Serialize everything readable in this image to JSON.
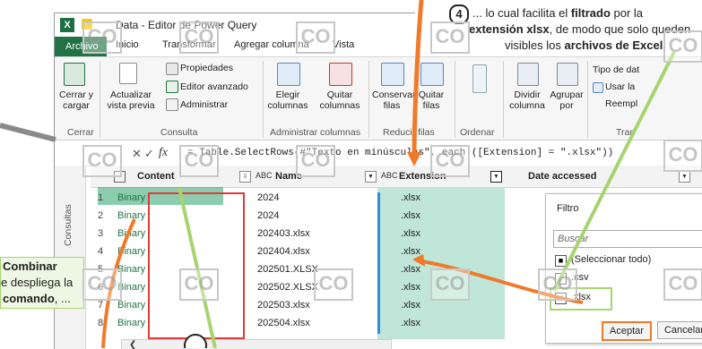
{
  "window": {
    "title": "Data - Editor de Power Query",
    "app_badge": "X"
  },
  "tabs": [
    "Archivo",
    "Inicio",
    "Transformar",
    "Agregar columna",
    "Vista"
  ],
  "ribbon": {
    "close_apply": "Cerrar y cargar",
    "refresh": "Actualizar vista previa",
    "properties": "Propiedades",
    "advanced_editor": "Editor avanzado",
    "manage": "Administrar",
    "choose_columns": "Elegir columnas",
    "remove_columns": "Quitar columnas",
    "keep_rows": "Conservar filas",
    "remove_rows": "Quitar filas",
    "split_column": "Dividir columna",
    "group_by": "Agrupar por",
    "data_type": "Tipo de dat",
    "use_first_row": "Usar la",
    "replace": "Reempl",
    "groups": {
      "close": "Cerrar",
      "query": "Consulta",
      "manage_cols": "Administrar columnas",
      "reduce_rows": "Reducir filas",
      "sort": "Ordenar",
      "transform": "Tran"
    }
  },
  "formula": {
    "fx": "fx",
    "text": "= Table.SelectRows(#\"Texto en minúsculas\", each ([Extension] = \".xlsx\"))"
  },
  "queries_label": "Consultas",
  "columns": [
    "Content",
    "Name",
    "Extension",
    "Date accessed"
  ],
  "rows": [
    {
      "n": "1",
      "content": "Binary",
      "name": "2024",
      "ext": ".xlsx"
    },
    {
      "n": "2",
      "content": "Binary",
      "name": "2024",
      "ext": ".xlsx"
    },
    {
      "n": "3",
      "content": "Binary",
      "name": "202403.xlsx",
      "ext": ".xlsx"
    },
    {
      "n": "4",
      "content": "Binary",
      "name": "202404.xlsx",
      "ext": ".xlsx"
    },
    {
      "n": "5",
      "content": "Binary",
      "name": "202501.XLSX",
      "ext": ".xlsx"
    },
    {
      "n": "6",
      "content": "Binary",
      "name": "202502.XLSX",
      "ext": ".xlsx"
    },
    {
      "n": "7",
      "content": "Binary",
      "name": "202503.xlsx",
      "ext": ".xlsx"
    },
    {
      "n": "8",
      "content": "Binary",
      "name": "202504.xlsx",
      "ext": ".xlsx"
    }
  ],
  "filter": {
    "title": "Filtro",
    "search_placeholder": "Buscar",
    "items": [
      {
        "label": "(Seleccionar todo)",
        "mark": "■"
      },
      {
        "label": ".csv",
        "mark": ""
      },
      {
        "label": ".xlsx",
        "mark": "✓"
      }
    ],
    "accept": "Aceptar",
    "cancel": "Cancelar"
  },
  "callouts": {
    "step_number": "4",
    "step4_line1a": "... lo cual facilita el ",
    "step4_line1b": "filtrado",
    "step4_line1c": " por la",
    "step4_line2a": "extensión xlsx",
    "step4_line2b": ", de modo que solo queden",
    "step4_line3a": "visibles los ",
    "step4_line3b": "archivos de Excel",
    "step4_line3c": ".",
    "left_line1": "Combinar",
    "left_line2": "e despliega la",
    "left_line3a": "comando",
    "left_line3b": ", ..."
  },
  "watermark": "CO",
  "colors": {
    "excel_green": "#217346",
    "orange_arrow": "#ee7a2a",
    "green_line": "#a8d46f",
    "red_box": "#e03b3b",
    "teal_selection": "#bfe6d8",
    "blue_bar": "#2f8fd8"
  }
}
